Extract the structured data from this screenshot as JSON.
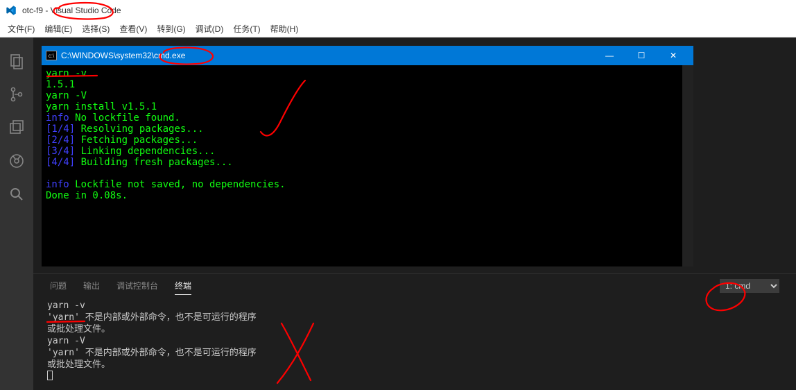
{
  "titlebar": {
    "title": "otc-f9 - Visual Studio Code"
  },
  "menu": {
    "file": "文件(F)",
    "edit": "编辑(E)",
    "select": "选择(S)",
    "view": "查看(V)",
    "goto": "转到(G)",
    "debug": "调试(D)",
    "tasks": "任务(T)",
    "help": "帮助(H)"
  },
  "cmd": {
    "path": "C:\\WINDOWS\\system32\\cmd.exe",
    "lines": {
      "l1": "yarn -v",
      "l2": "1.5.1",
      "l3": "yarn -V",
      "l4": "yarn install v1.5.1",
      "l5a": "info",
      "l5b": " No lockfile found.",
      "l6a": "[1/4]",
      "l6b": " Resolving packages...",
      "l7a": "[2/4]",
      "l7b": " Fetching packages...",
      "l8a": "[3/4]",
      "l8b": " Linking dependencies...",
      "l9a": "[4/4]",
      "l9b": " Building fresh packages...",
      "l10a": "info",
      "l10b": " Lockfile not saved, no dependencies.",
      "l11": "Done in 0.08s."
    },
    "winbtn": {
      "min": "—",
      "max": "☐",
      "close": "✕"
    }
  },
  "panel": {
    "tabs": {
      "problems": "问题",
      "output": "输出",
      "debug": "调试控制台",
      "terminal": "终端"
    },
    "select": {
      "option1": "1: cmd"
    },
    "terminal": {
      "t1": "yarn -v",
      "t2": "'yarn' 不是内部或外部命令，也不是可运行的程序",
      "t3": "或批处理文件。",
      "t4": "yarn -V",
      "t5": "'yarn' 不是内部或外部命令，也不是可运行的程序",
      "t6": "或批处理文件。"
    }
  }
}
